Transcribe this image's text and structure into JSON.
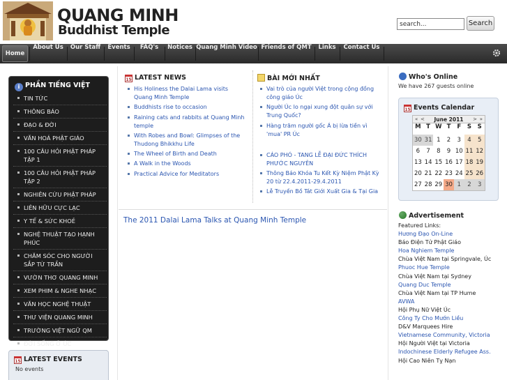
{
  "header": {
    "title_line1": "QUANG MINH",
    "title_line2": "Buddhist Temple",
    "search_placeholder": "search...",
    "search_button": "Search"
  },
  "nav": {
    "items": [
      {
        "label": "Home",
        "active": true
      },
      {
        "label": "About Us"
      },
      {
        "label": "Our Staff"
      },
      {
        "label": "Events"
      },
      {
        "label": "FAQ's"
      },
      {
        "label": "Notices"
      },
      {
        "label": "Quang Minh Video"
      },
      {
        "label": "Friends of QMT"
      },
      {
        "label": "Links"
      },
      {
        "label": "Contact Us"
      }
    ]
  },
  "sidebar": {
    "title": "PHẦN TIẾNG VIỆT",
    "items": [
      "TIN TỨC",
      "THÔNG BÁO",
      "ĐẠO & ĐỜI",
      "VĂN HOÁ PHẬT GIÁO",
      "100 CÂU HỎI PHẬT PHÁP TẬP 1",
      "100 CÂU HỎI PHẬT PHÁP TẬP 2",
      "NGHIÊN CỨU PHẬT PHÁP",
      "LIÊN HỮU CỰC LẠC",
      "Y TẾ & SỨC KHOẺ",
      "NGHỆ THUẬT TẠO HẠNH PHÚC",
      "CHĂM SÓC CHO NGƯỜI SẮP TỪ TRẦN",
      "VƯỜN THƠ QUANG MINH",
      "XEM PHIM & NGHE NHẠC",
      "VĂN HỌC NGHỆ THUẬT",
      "THƯ VIỆN QUANG MINH",
      "TRƯỜNG VIỆT NGỮ QM",
      "ĐỜI SỐNG Ở ÚC"
    ]
  },
  "latest_events": {
    "title": "LATEST EVENTS",
    "empty": "No events"
  },
  "latest_news": {
    "title": "LATEST NEWS",
    "items": [
      "His Holiness the Dalai Lama visits Quang Minh Temple",
      "Buddhists rise to occasion",
      "Raining cats and rabbits at Quang Minh temple",
      "With Robes and Bowl: Glimpses of the Thudong Bhikkhu Life",
      "The Wheel of Birth and Death",
      "A Walk in the Woods",
      "Practical Advice for Meditators"
    ]
  },
  "new_posts": {
    "title": "BÀI MỚI NHẤT",
    "items": [
      "Vai trò của người Việt trong cộng đồng công giáo Úc",
      "Người Úc lo ngại xung đột quân sự với Trung Quốc?",
      "Hàng trăm người gốc Á bị lừa tiền vì 'mua' PR Úc",
      "CÁO PHÓ - TANG LỄ ĐẠI ĐỨC THÍCH PHƯỚC NGUYÊN",
      "Thông Báo Khóa Tu Kết Kỳ Niệm Phật Kỳ 20 từ 22.4.2011-29.4.2011",
      "Lễ Truyền Bồ Tát Giới Xuất Gia & Tại Gia"
    ]
  },
  "article": {
    "title": "The 2011 Dalai Lama Talks at Quang Minh Temple"
  },
  "whos_online": {
    "title": "Who's Online",
    "text": "We have 267 guests online"
  },
  "calendar": {
    "title": "Events Calendar",
    "prev_year": "«",
    "prev_month": "<",
    "month": "June 2011",
    "next_month": ">",
    "next_year": "»",
    "days_of_week": [
      "M",
      "T",
      "W",
      "T",
      "F",
      "S",
      "S"
    ],
    "weeks": [
      [
        {
          "d": "30",
          "o": true
        },
        {
          "d": "31",
          "o": true
        },
        {
          "d": "1"
        },
        {
          "d": "2"
        },
        {
          "d": "3"
        },
        {
          "d": "4",
          "w": true
        },
        {
          "d": "5",
          "w": true
        }
      ],
      [
        {
          "d": "6"
        },
        {
          "d": "7"
        },
        {
          "d": "8"
        },
        {
          "d": "9"
        },
        {
          "d": "10"
        },
        {
          "d": "11",
          "w": true
        },
        {
          "d": "12",
          "w": true
        }
      ],
      [
        {
          "d": "13"
        },
        {
          "d": "14"
        },
        {
          "d": "15"
        },
        {
          "d": "16"
        },
        {
          "d": "17"
        },
        {
          "d": "18",
          "w": true
        },
        {
          "d": "19",
          "w": true
        }
      ],
      [
        {
          "d": "20"
        },
        {
          "d": "21"
        },
        {
          "d": "22"
        },
        {
          "d": "23"
        },
        {
          "d": "24"
        },
        {
          "d": "25",
          "w": true
        },
        {
          "d": "26",
          "w": true
        }
      ],
      [
        {
          "d": "27"
        },
        {
          "d": "28"
        },
        {
          "d": "29"
        },
        {
          "d": "30",
          "t": true
        },
        {
          "d": "1",
          "o": true
        },
        {
          "d": "2",
          "o": true
        },
        {
          "d": "3",
          "o": true
        }
      ]
    ],
    "colors": {
      "other": "#d7d7d7",
      "today": "#f4a988",
      "weekend": "#f6e3cc"
    }
  },
  "advertisement": {
    "title": "Advertisement",
    "lines": [
      {
        "text": "Featured Links:",
        "link": false
      },
      {
        "text": "Hương Đạo On-Line",
        "link": true
      },
      {
        "text": "Báo Điện Tử Phật Giáo",
        "link": false
      },
      {
        "text": "Hoa Nghiem Temple",
        "link": true
      },
      {
        "text": "Chùa Việt Nam tại Springvale, Úc",
        "link": false
      },
      {
        "text": "Phuoc Hue Temple",
        "link": true
      },
      {
        "text": "Chùa Việt Nam tại Sydney",
        "link": false
      },
      {
        "text": "Quang Duc Temple",
        "link": true
      },
      {
        "text": "Chùa Việt Nam tại TP Hume",
        "link": false
      },
      {
        "text": "AVWA",
        "link": true
      },
      {
        "text": "Hội Phụ Nữ Việt Úc",
        "link": false
      },
      {
        "text": "Công Ty Cho Mướn Liều",
        "link": true
      },
      {
        "text": "D&V Marquees Hire",
        "link": false
      },
      {
        "text": "Vietnamese Community, Victoria",
        "link": true
      },
      {
        "text": "Hội Người Việt tại Victoria",
        "link": false
      },
      {
        "text": "Indochinese Elderly Refugee Ass.",
        "link": true
      },
      {
        "text": "Hội Cao Niên Tỵ Nạn",
        "link": false
      }
    ]
  },
  "colors": {
    "link": "#2a55b0",
    "nav_bg": "#333333",
    "sidebar_bg": "#1d1d1d"
  }
}
